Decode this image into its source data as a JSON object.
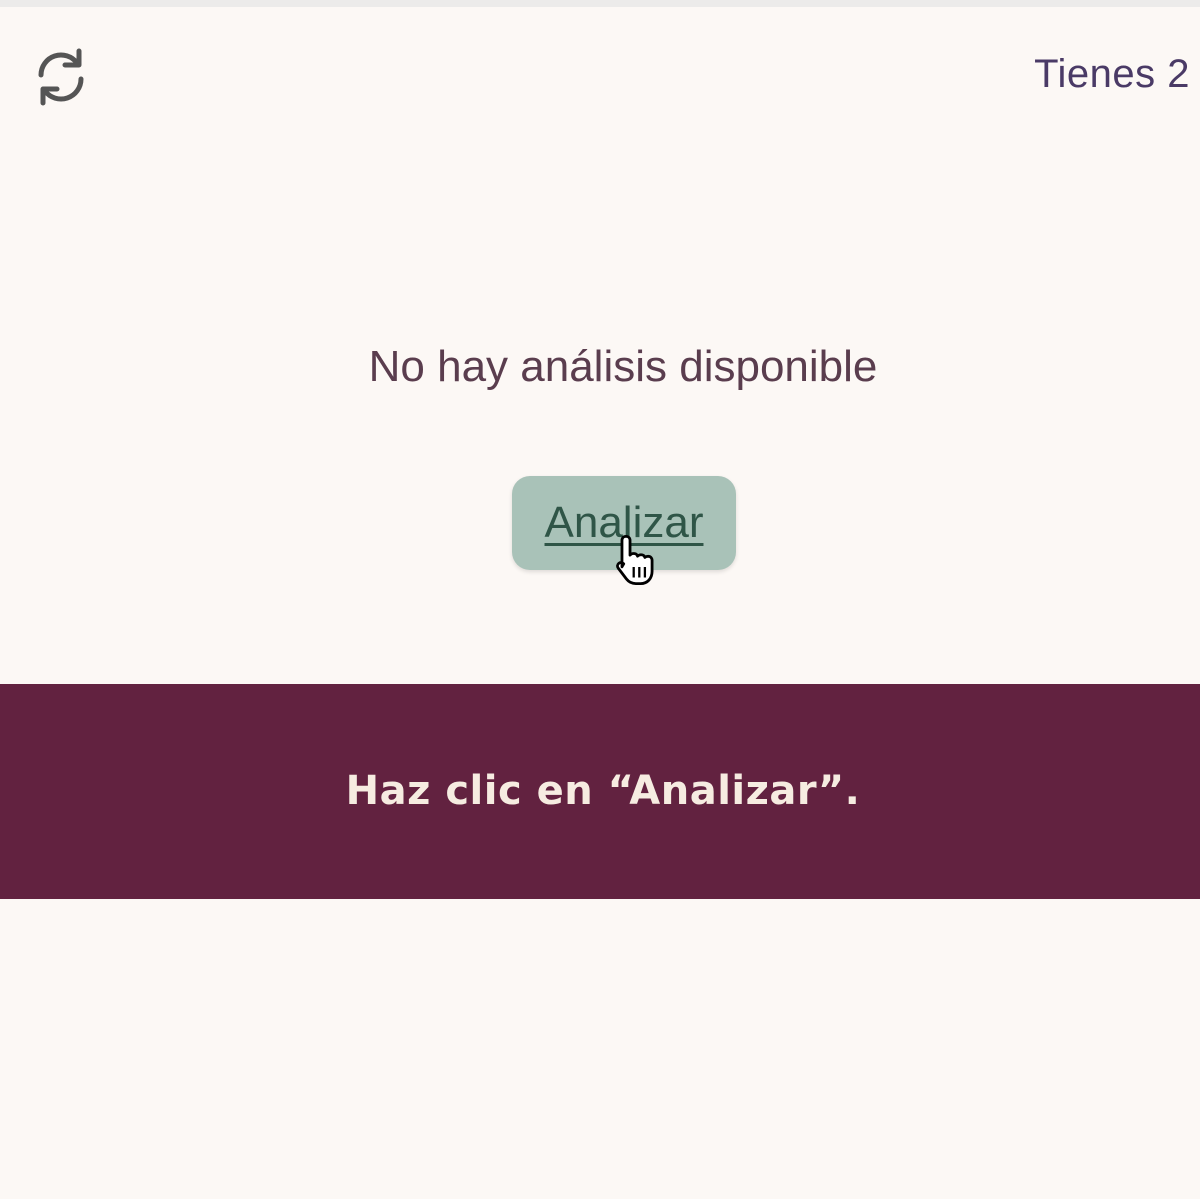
{
  "header": {
    "refresh_icon": "refresh-icon",
    "tienes_text": "Tienes 2"
  },
  "main": {
    "empty_message": "No hay análisis disponible",
    "analyze_button_label": "Analizar",
    "cursor_icon": "hand-pointer-icon"
  },
  "caption": {
    "text": "Haz clic en “Analizar”."
  },
  "colors": {
    "background": "#fcf8f5",
    "caption_band": "#622240",
    "caption_text": "#f6ece1",
    "button_background": "#a9c2b8",
    "button_text": "#2f5547",
    "message_text": "#5a3d4e",
    "header_text": "#4a3a66"
  }
}
